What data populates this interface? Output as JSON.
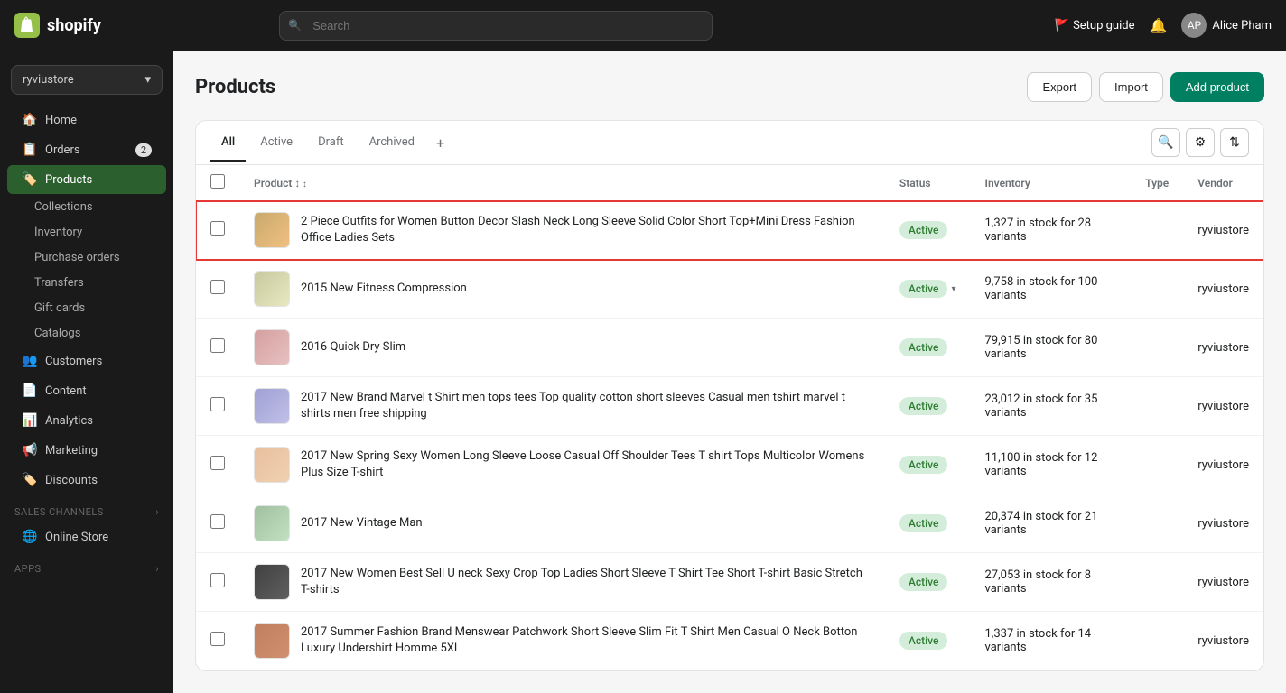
{
  "topnav": {
    "logo_text": "shopify",
    "search_placeholder": "Search",
    "setup_guide_label": "Setup guide",
    "user_name": "Alice Pham"
  },
  "sidebar": {
    "store_name": "ryviustore",
    "nav_items": [
      {
        "id": "home",
        "label": "Home",
        "icon": "🏠",
        "active": false
      },
      {
        "id": "orders",
        "label": "Orders",
        "icon": "📋",
        "badge": "2",
        "active": false
      },
      {
        "id": "products",
        "label": "Products",
        "icon": "🏷️",
        "active": true
      },
      {
        "id": "customers",
        "label": "Customers",
        "icon": "👥",
        "active": false
      },
      {
        "id": "content",
        "label": "Content",
        "icon": "📄",
        "active": false
      },
      {
        "id": "analytics",
        "label": "Analytics",
        "icon": "📊",
        "active": false
      },
      {
        "id": "marketing",
        "label": "Marketing",
        "icon": "📢",
        "active": false
      },
      {
        "id": "discounts",
        "label": "Discounts",
        "icon": "🏷️",
        "active": false
      }
    ],
    "products_subitems": [
      {
        "id": "collections",
        "label": "Collections"
      },
      {
        "id": "inventory",
        "label": "Inventory"
      },
      {
        "id": "purchase-orders",
        "label": "Purchase orders"
      },
      {
        "id": "transfers",
        "label": "Transfers"
      },
      {
        "id": "gift-cards",
        "label": "Gift cards"
      },
      {
        "id": "catalogs",
        "label": "Catalogs"
      }
    ],
    "sales_channels_label": "Sales channels",
    "sales_channels": [
      {
        "id": "online-store",
        "label": "Online Store",
        "icon": "🌐"
      }
    ],
    "apps_label": "Apps",
    "apps_expand_icon": "›"
  },
  "page": {
    "title": "Products",
    "export_label": "Export",
    "import_label": "Import",
    "add_product_label": "Add product"
  },
  "tabs": [
    {
      "id": "all",
      "label": "All",
      "active": true
    },
    {
      "id": "active",
      "label": "Active",
      "active": false
    },
    {
      "id": "draft",
      "label": "Draft",
      "active": false
    },
    {
      "id": "archived",
      "label": "Archived",
      "active": false
    }
  ],
  "table": {
    "columns": [
      {
        "id": "product",
        "label": "Product",
        "sortable": true
      },
      {
        "id": "status",
        "label": "Status",
        "sortable": false
      },
      {
        "id": "inventory",
        "label": "Inventory",
        "sortable": false
      },
      {
        "id": "type",
        "label": "Type",
        "sortable": false
      },
      {
        "id": "vendor",
        "label": "Vendor",
        "sortable": false
      }
    ],
    "rows": [
      {
        "id": 1,
        "highlighted": true,
        "thumb_class": "thumb-1",
        "product_name": "2 Piece Outfits for Women Button Decor Slash Neck Long Sleeve Solid Color Short Top+Mini Dress Fashion Office Ladies Sets",
        "status": "Active",
        "inventory": "1,327 in stock for 28 variants",
        "type": "",
        "vendor": "ryviustore"
      },
      {
        "id": 2,
        "highlighted": false,
        "thumb_class": "thumb-2",
        "product_name": "2015 New Fitness Compression",
        "status": "Active",
        "has_dropdown": true,
        "inventory": "9,758 in stock for 100 variants",
        "type": "",
        "vendor": "ryviustore"
      },
      {
        "id": 3,
        "highlighted": false,
        "thumb_class": "thumb-3",
        "product_name": "2016 Quick Dry Slim",
        "status": "Active",
        "inventory": "79,915 in stock for 80 variants",
        "type": "",
        "vendor": "ryviustore"
      },
      {
        "id": 4,
        "highlighted": false,
        "thumb_class": "thumb-4",
        "product_name": "2017 New Brand Marvel t Shirt men tops tees Top quality cotton short sleeves Casual men tshirt marvel t shirts men free shipping",
        "status": "Active",
        "inventory": "23,012 in stock for 35 variants",
        "type": "",
        "vendor": "ryviustore"
      },
      {
        "id": 5,
        "highlighted": false,
        "thumb_class": "thumb-5",
        "product_name": "2017 New Spring Sexy Women Long Sleeve Loose Casual Off Shoulder Tees T shirt Tops Multicolor Womens Plus Size T-shirt",
        "status": "Active",
        "inventory": "11,100 in stock for 12 variants",
        "type": "",
        "vendor": "ryviustore"
      },
      {
        "id": 6,
        "highlighted": false,
        "thumb_class": "thumb-6",
        "product_name": "2017 New Vintage Man",
        "status": "Active",
        "inventory": "20,374 in stock for 21 variants",
        "type": "",
        "vendor": "ryviustore"
      },
      {
        "id": 7,
        "highlighted": false,
        "thumb_class": "thumb-7",
        "product_name": "2017 New Women Best Sell U neck Sexy Crop Top Ladies Short Sleeve T Shirt Tee Short T-shirt Basic Stretch T-shirts",
        "status": "Active",
        "inventory": "27,053 in stock for 8 variants",
        "type": "",
        "vendor": "ryviustore"
      },
      {
        "id": 8,
        "highlighted": false,
        "thumb_class": "thumb-8",
        "product_name": "2017 Summer Fashion Brand Menswear Patchwork Short Sleeve Slim Fit T Shirt Men Casual O Neck Botton Luxury Undershirt Homme 5XL",
        "status": "Active",
        "inventory": "1,337 in stock for 14 variants",
        "type": "",
        "vendor": "ryviustore"
      }
    ]
  }
}
